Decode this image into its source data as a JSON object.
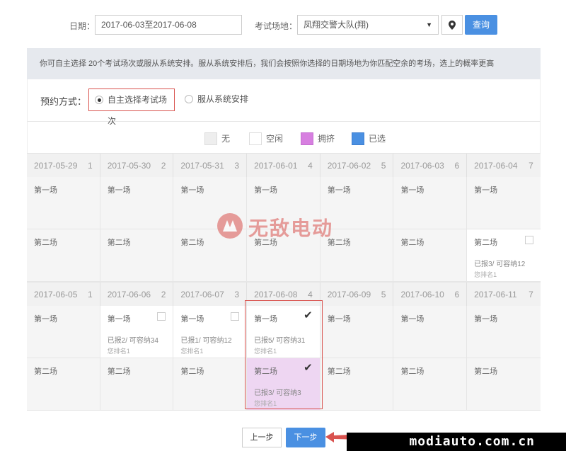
{
  "filter": {
    "date_label": "日期：",
    "date_value": "2017-06-03至2017-06-08",
    "venue_label": "考试场地：",
    "venue_value": "凤翔交警大队(翔)",
    "query_label": "查询"
  },
  "notice": "你可自主选择 20个考试场次或服从系统安排。服从系统安排后，我们会按照你选择的日期场地为你匹配空余的考场，选上的概率更高",
  "mode": {
    "label": "预约方式：",
    "options": [
      {
        "label": "自主选择考试场次",
        "selected": true
      },
      {
        "label": "服从系统安排",
        "selected": false
      }
    ]
  },
  "legend": [
    {
      "label": "无",
      "color": "#eeeeee"
    },
    {
      "label": "空闲",
      "color": "#ffffff"
    },
    {
      "label": "拥挤",
      "color": "#d77fe0"
    },
    {
      "label": "已选",
      "color": "#4a90e2"
    }
  ],
  "calendar": {
    "weeks": [
      {
        "days": [
          {
            "date": "2017-05-29",
            "dow": "1"
          },
          {
            "date": "2017-05-30",
            "dow": "2"
          },
          {
            "date": "2017-05-31",
            "dow": "3"
          },
          {
            "date": "2017-06-01",
            "dow": "4"
          },
          {
            "date": "2017-06-02",
            "dow": "5"
          },
          {
            "date": "2017-06-03",
            "dow": "6"
          },
          {
            "date": "2017-06-04",
            "dow": "7"
          }
        ],
        "sessions": [
          [
            {
              "title": "第一场"
            },
            {
              "title": "第一场"
            },
            {
              "title": "第一场"
            },
            {
              "title": "第一场"
            },
            {
              "title": "第一场"
            },
            {
              "title": "第一场"
            },
            {
              "title": "第一场"
            }
          ],
          [
            {
              "title": "第二场"
            },
            {
              "title": "第二场"
            },
            {
              "title": "第二场"
            },
            {
              "title": "第二场"
            },
            {
              "title": "第二场"
            },
            {
              "title": "第二场"
            },
            {
              "title": "第二场",
              "info": "已报3/ 可容纳12",
              "rank": "您排名1"
            }
          ]
        ]
      },
      {
        "days": [
          {
            "date": "2017-06-05",
            "dow": "1"
          },
          {
            "date": "2017-06-06",
            "dow": "2"
          },
          {
            "date": "2017-06-07",
            "dow": "3"
          },
          {
            "date": "2017-06-08",
            "dow": "4"
          },
          {
            "date": "2017-06-09",
            "dow": "5"
          },
          {
            "date": "2017-06-10",
            "dow": "6"
          },
          {
            "date": "2017-06-11",
            "dow": "7"
          }
        ],
        "sessions": [
          [
            {
              "title": "第一场"
            },
            {
              "title": "第一场",
              "info": "已报2/ 可容纳34",
              "rank": "您排名1"
            },
            {
              "title": "第一场",
              "info": "已报1/ 可容纳12",
              "rank": "您排名1"
            },
            {
              "title": "第一场",
              "info": "已报5/ 可容纳31",
              "rank": "您排名1"
            },
            {
              "title": "第一场"
            },
            {
              "title": "第一场"
            },
            {
              "title": "第一场"
            }
          ],
          [
            {
              "title": "第二场"
            },
            {
              "title": "第二场"
            },
            {
              "title": "第二场"
            },
            {
              "title": "第二场",
              "info": "已报3/ 可容纳3",
              "rank": "您排名1"
            },
            {
              "title": "第二场"
            },
            {
              "title": "第二场"
            },
            {
              "title": "第二场"
            }
          ]
        ]
      }
    ]
  },
  "nav": {
    "prev_label": "上一步",
    "next_label": "下一步"
  },
  "watermark": {
    "center_text": "无敌电动",
    "bottom_text": "modiauto.com.cn"
  }
}
